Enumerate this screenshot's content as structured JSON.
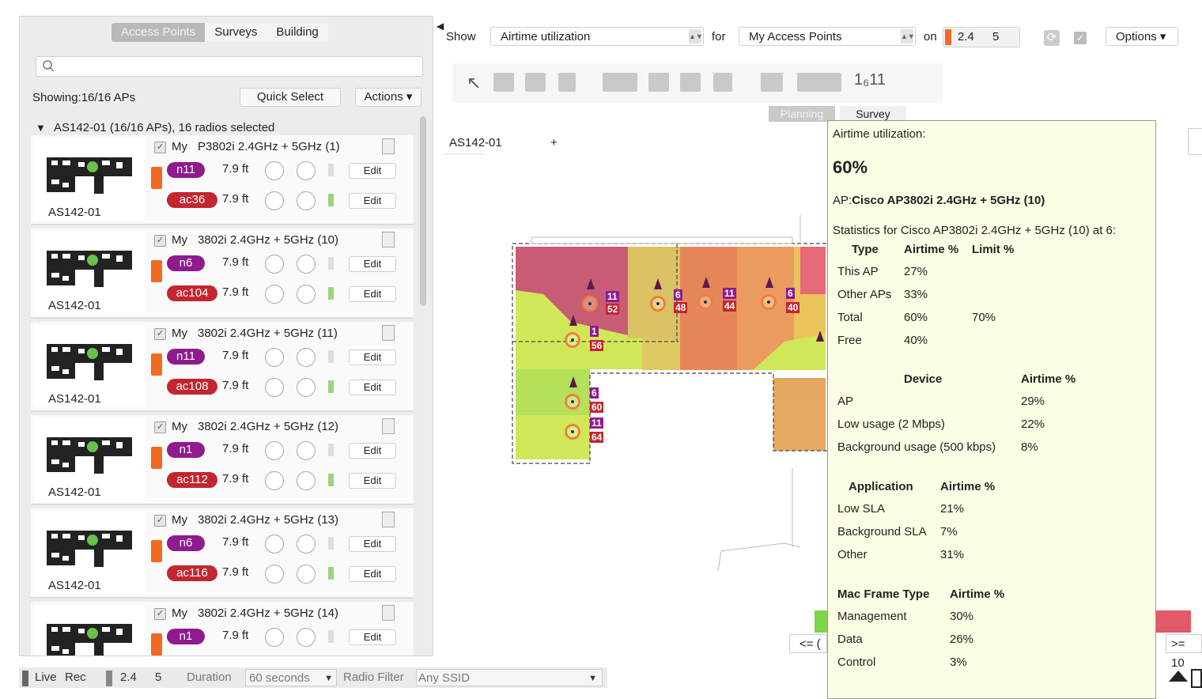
{
  "left_tabs": [
    "Access Points",
    "Surveys",
    "Building"
  ],
  "search": {
    "placeholder": ""
  },
  "showing": "Showing:16/16 APs",
  "quick_select": "Quick Select",
  "actions": "Actions ▾",
  "tree_header": "AS142-01 (16/16 APs), 16 radios selected",
  "cards": [
    {
      "cap": "AS142-01",
      "my": "My",
      "name": "P3802i 2.4GHz + 5GHz (1)",
      "r1": "n11",
      "r2": "ac36",
      "h1": "7.9 ft",
      "h2": "7.9 ft",
      "edit": "Edit"
    },
    {
      "cap": "AS142-01",
      "my": "My",
      "name": "3802i 2.4GHz + 5GHz (10)",
      "r1": "n6",
      "r2": "ac104",
      "h1": "7.9 ft",
      "h2": "7.9 ft",
      "edit": "Edit"
    },
    {
      "cap": "AS142-01",
      "my": "My",
      "name": "3802i 2.4GHz + 5GHz (11)",
      "r1": "n11",
      "r2": "ac108",
      "h1": "7.9 ft",
      "h2": "7.9 ft",
      "edit": "Edit"
    },
    {
      "cap": "AS142-01",
      "my": "My",
      "name": "3802i 2.4GHz + 5GHz (12)",
      "r1": "n1",
      "r2": "ac112",
      "h1": "7.9 ft",
      "h2": "7.9 ft",
      "edit": "Edit"
    },
    {
      "cap": "AS142-01",
      "my": "My",
      "name": "3802i 2.4GHz + 5GHz (13)",
      "r1": "n6",
      "r2": "ac116",
      "h1": "7.9 ft",
      "h2": "7.9 ft",
      "edit": "Edit"
    },
    {
      "cap": "",
      "my": "My",
      "name": "3802i 2.4GHz + 5GHz (14)",
      "r1": "n1",
      "r2": "",
      "h1": "7.9 ft",
      "h2": "",
      "edit": "Edit"
    }
  ],
  "toolbar": {
    "show": "Show",
    "metric": "Airtime utilization",
    "for": "for",
    "scope": "My Access Points",
    "on": "on",
    "band1": "2.4",
    "band2": "5",
    "options": "Options ▾"
  },
  "mode_tabs": [
    "Planning",
    "Survey"
  ],
  "floor_tab": "AS142-01",
  "floor_add": "+",
  "legend_left": "<= (",
  "legend_right": ">= 10",
  "map_labels": [
    {
      "top": "11",
      "bot": "52"
    },
    {
      "top": "6",
      "bot": "48"
    },
    {
      "top": "11",
      "bot": "44"
    },
    {
      "top": "6",
      "bot": "40"
    },
    {
      "top": "1",
      "bot": "56"
    },
    {
      "top": "6",
      "bot": "60"
    },
    {
      "top": "11",
      "bot": "64"
    }
  ],
  "tooltip": {
    "title": "Airtime utilization:",
    "value": "60%",
    "ap_prefix": "AP:",
    "ap": "Cisco AP3802i 2.4GHz + 5GHz (10)",
    "stats": "Statistics for Cisco AP3802i 2.4GHz + 5GHz (10) at 6:",
    "type_headers": [
      "Type",
      "Airtime %",
      "Limit %"
    ],
    "type_rows": [
      [
        "This AP",
        "27%",
        ""
      ],
      [
        "Other APs",
        "33%",
        ""
      ],
      [
        "Total",
        "60%",
        "70%"
      ],
      [
        "Free",
        "40%",
        ""
      ]
    ],
    "device_headers": [
      "Device",
      "Airtime %"
    ],
    "device_rows": [
      [
        "AP",
        "29%"
      ],
      [
        "Low usage (2 Mbps)",
        "22%"
      ],
      [
        "Background usage (500 kbps)",
        "8%"
      ]
    ],
    "app_headers": [
      "Application",
      "Airtime %"
    ],
    "app_rows": [
      [
        "Low SLA",
        "21%"
      ],
      [
        "Background SLA",
        "7%"
      ],
      [
        "Other",
        "31%"
      ]
    ],
    "mac_headers": [
      "Mac Frame Type",
      "Airtime %"
    ],
    "mac_rows": [
      [
        "Management",
        "30%"
      ],
      [
        "Data",
        "26%"
      ],
      [
        "Control",
        "3%"
      ]
    ]
  },
  "bottom": {
    "live": "Live",
    "rec": "Rec",
    "band1": "2.4",
    "band2": "5",
    "duration_label": "Duration",
    "duration": "60 seconds",
    "filter_label": "Radio Filter",
    "filter": "Any SSID"
  }
}
